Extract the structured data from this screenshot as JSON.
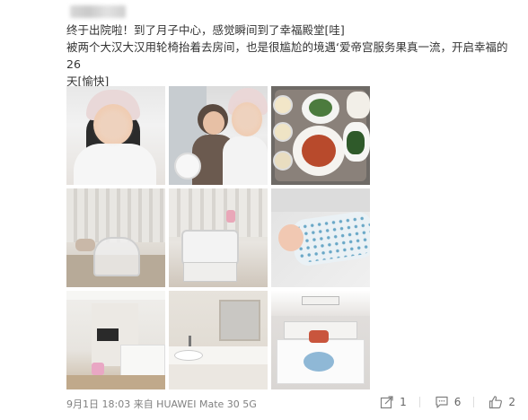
{
  "post": {
    "text_line1": "终于出院啦！到了月子中心，感觉瞬间到了幸福殿堂[哇]",
    "text_line2": "被两个大汉大汉用轮椅抬着去房间，也是很尴尬的境遇‘爱帝宫服务果真一流，开启幸福的26",
    "text_line3": "天[愉快]"
  },
  "photos": [
    {
      "name": "photo-selfie"
    },
    {
      "name": "photo-family-with-newborn"
    },
    {
      "name": "photo-meal-tray"
    },
    {
      "name": "photo-crib-room"
    },
    {
      "name": "photo-crib-and-cart"
    },
    {
      "name": "photo-sleeping-baby"
    },
    {
      "name": "photo-living-room"
    },
    {
      "name": "photo-bathroom-vanity"
    },
    {
      "name": "photo-bedroom"
    }
  ],
  "footer": {
    "meta": "9月1日 18:03 来自 HUAWEI Mate 30 5G",
    "share_count": "1",
    "comment_count": "6",
    "like_count": "2",
    "share_icon": "share-icon",
    "comment_icon": "comment-icon",
    "like_icon": "thumbs-up-icon"
  }
}
